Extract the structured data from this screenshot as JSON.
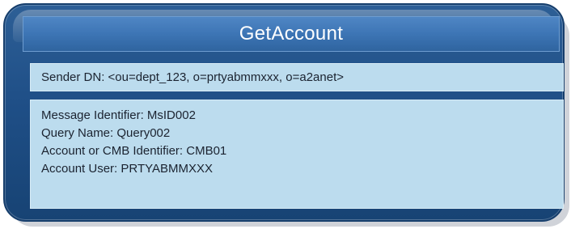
{
  "message": {
    "title": "GetAccount",
    "sender": "Sender DN: <ou=dept_123, o=prtyabmmxxx, o=a2anet>",
    "fields": [
      "Message Identifier: MsID002",
      "Query Name: Query002",
      "Account or CMB Identifier: CMB01",
      "Account User: PRTYABMMXXX"
    ]
  },
  "colors": {
    "outer_fill": "#1f4f87",
    "title_band": "#3d75b5",
    "content_fill": "#bcdcee",
    "text": "#1b2330",
    "title_text": "#ffffff"
  }
}
